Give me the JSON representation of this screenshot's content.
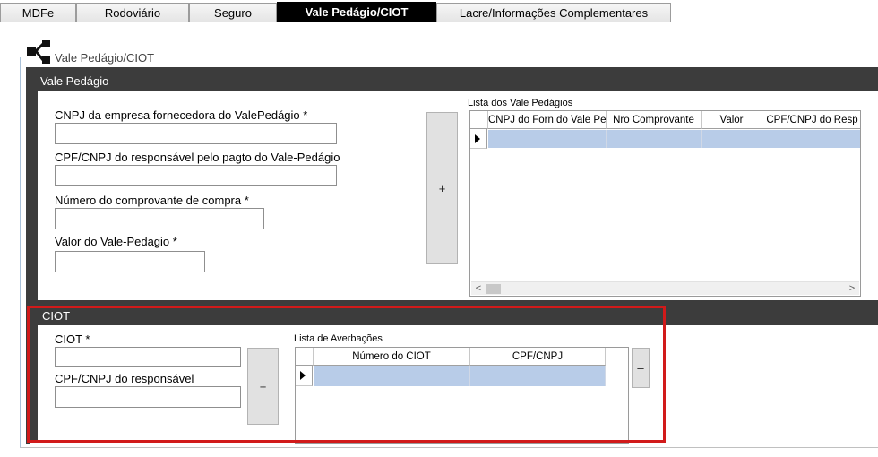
{
  "tabs": [
    {
      "label": "MDFe"
    },
    {
      "label": "Rodoviário"
    },
    {
      "label": "Seguro"
    },
    {
      "label": "Vale Pedágio/CIOT",
      "active": true
    },
    {
      "label": "Lacre/Informações Complementares"
    }
  ],
  "section_title": "Vale Pedágio/CIOT",
  "vale_pedagio": {
    "title": "Vale Pedágio",
    "fields": {
      "cnpj_fornecedora_label": "CNPJ da empresa fornecedora do ValePedágio  *",
      "cpf_responsavel_label": "CPF/CNPJ do responsável pelo pagto do Vale-Pedágio",
      "numero_comprovante_label": "Número do comprovante de compra  *",
      "valor_label": "Valor do Vale-Pedagio *"
    },
    "add_button": "+",
    "list_title": "Lista dos Vale Pedágios",
    "columns": [
      "CNPJ do Forn do Vale Ped",
      "Nro Comprovante",
      "Valor",
      "CPF/CNPJ do Resp"
    ],
    "scroll_left": "<",
    "scroll_right": ">"
  },
  "ciot": {
    "title": "CIOT",
    "fields": {
      "ciot_label": "CIOT *",
      "cpf_responsavel_label": "CPF/CNPJ do responsável"
    },
    "add_button": "+",
    "remove_button": "–",
    "list_title": "Lista de Averbações",
    "columns": [
      "Número do CIOT",
      "CPF/CNPJ"
    ]
  },
  "colors": {
    "panel_header": "#3c3c3c",
    "selected_row": "#b8cce8",
    "highlight_border": "#d11a1a",
    "active_tab": "#000000"
  }
}
